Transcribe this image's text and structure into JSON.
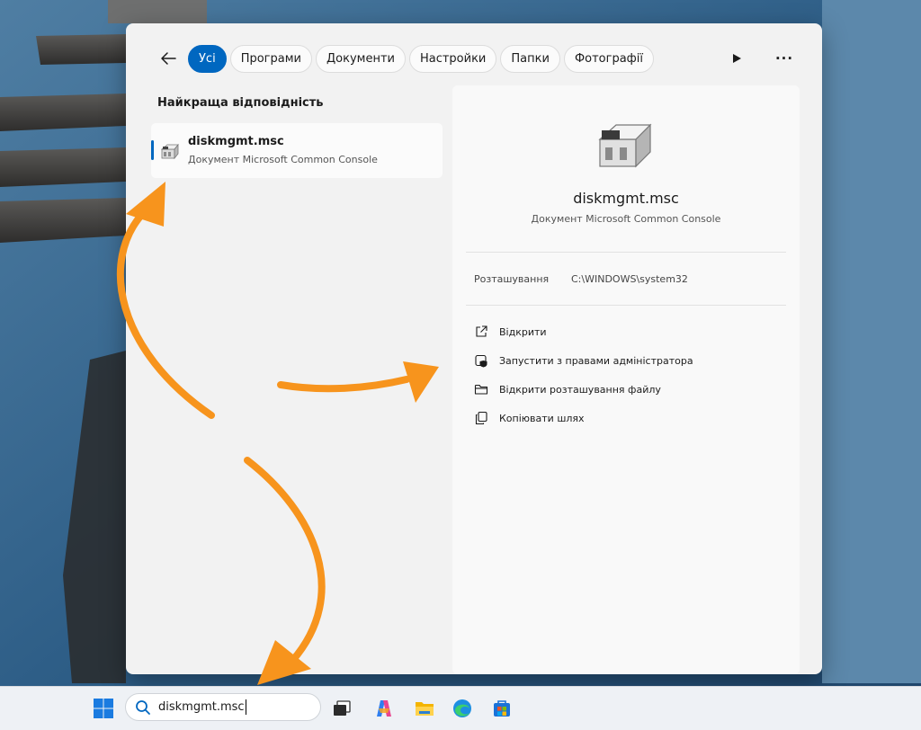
{
  "filters": {
    "tabs": [
      {
        "label": "Усі",
        "active": true
      },
      {
        "label": "Програми",
        "active": false
      },
      {
        "label": "Документи",
        "active": false
      },
      {
        "label": "Настройки",
        "active": false
      },
      {
        "label": "Папки",
        "active": false
      },
      {
        "label": "Фотографії",
        "active": false
      }
    ]
  },
  "results": {
    "section_title": "Найкраща відповідність",
    "best_match": {
      "title": "diskmgmt.msc",
      "subtitle": "Документ Microsoft Common Console",
      "icon": "mmc-console-icon"
    }
  },
  "details": {
    "title": "diskmgmt.msc",
    "subtitle": "Документ Microsoft Common Console",
    "location_label": "Розташування",
    "location_value": "C:\\WINDOWS\\system32",
    "actions": [
      {
        "label": "Відкрити",
        "icon": "open-external-icon"
      },
      {
        "label": "Запустити з правами адміністратора",
        "icon": "admin-shield-icon"
      },
      {
        "label": "Відкрити розташування файлу",
        "icon": "folder-icon"
      },
      {
        "label": "Копіювати шлях",
        "icon": "copy-icon"
      }
    ]
  },
  "taskbar": {
    "search_value": "diskmgmt.msc",
    "apps": [
      "start-icon",
      "task-view-icon",
      "copilot-icon",
      "file-explorer-icon",
      "edge-icon",
      "store-icon"
    ]
  },
  "colors": {
    "accent": "#0067c0",
    "annotation_arrow": "#f7941d",
    "panel_bg": "#f2f2f2"
  }
}
